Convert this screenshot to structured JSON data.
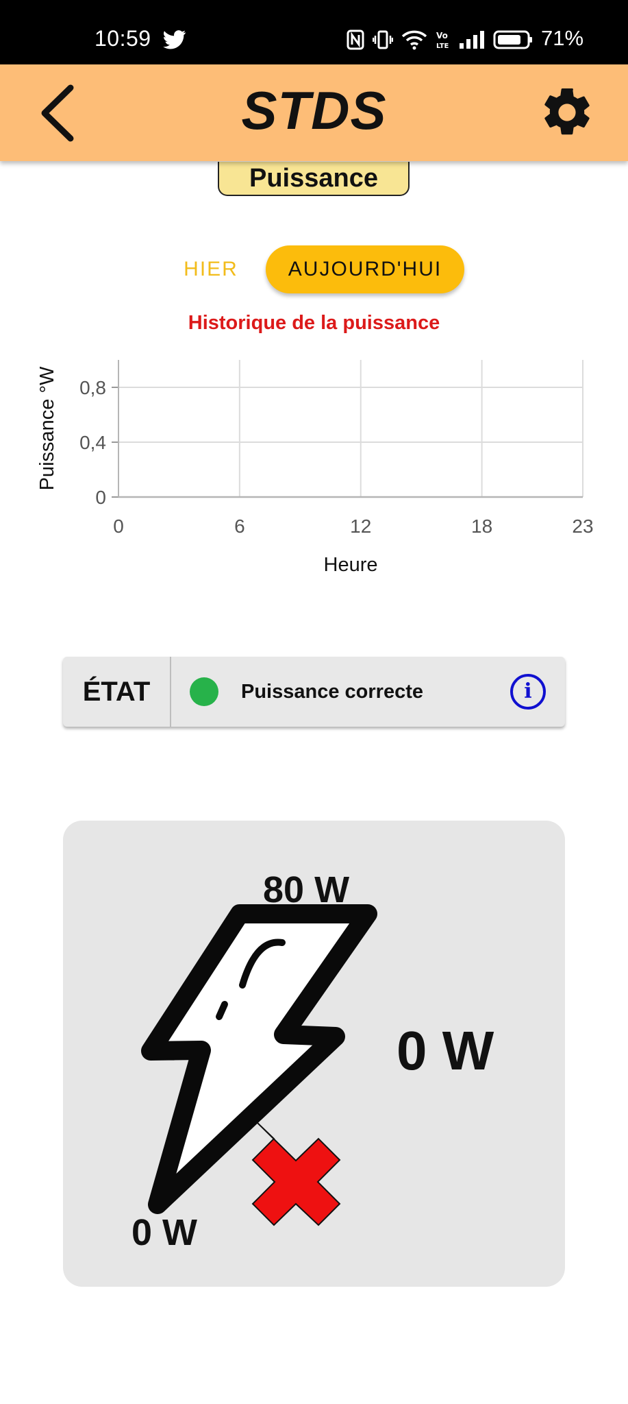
{
  "status_bar": {
    "time": "10:59",
    "battery_pct": "71%",
    "icons": [
      "twitter-icon",
      "nfc-icon",
      "vibrate-icon",
      "wifi-icon",
      "volte-icon",
      "signal-icon",
      "battery-icon"
    ]
  },
  "app_bar": {
    "title": "STDS",
    "back_icon": "chevron-left-icon",
    "settings_icon": "gear-icon",
    "color": "#fdbd77"
  },
  "page_label": "Puissance",
  "day_toggle": {
    "yesterday": "HIER",
    "today": "AUJOURD'HUI",
    "selected": "today",
    "accent": "#fcbc0c"
  },
  "chart_data": {
    "type": "line",
    "title": "Historique de la puissance",
    "xlabel": "Heure",
    "ylabel": "Puissance °W",
    "x_ticks": [
      "0",
      "6",
      "12",
      "18",
      "23"
    ],
    "y_ticks": [
      "0",
      "0,4",
      "0,8"
    ],
    "xlim": [
      0,
      23
    ],
    "ylim": [
      0,
      1
    ],
    "series": [],
    "grid": true
  },
  "state": {
    "label": "ÉTAT",
    "status_text": "Puissance correcte",
    "status_color": "#27b24a",
    "info_icon": "info-icon"
  },
  "power_card": {
    "top_value": "80 W",
    "right_value": "0 W",
    "bottom_value": "0 W",
    "icons": [
      "lightning-bolt-icon",
      "red-cross-icon"
    ]
  }
}
